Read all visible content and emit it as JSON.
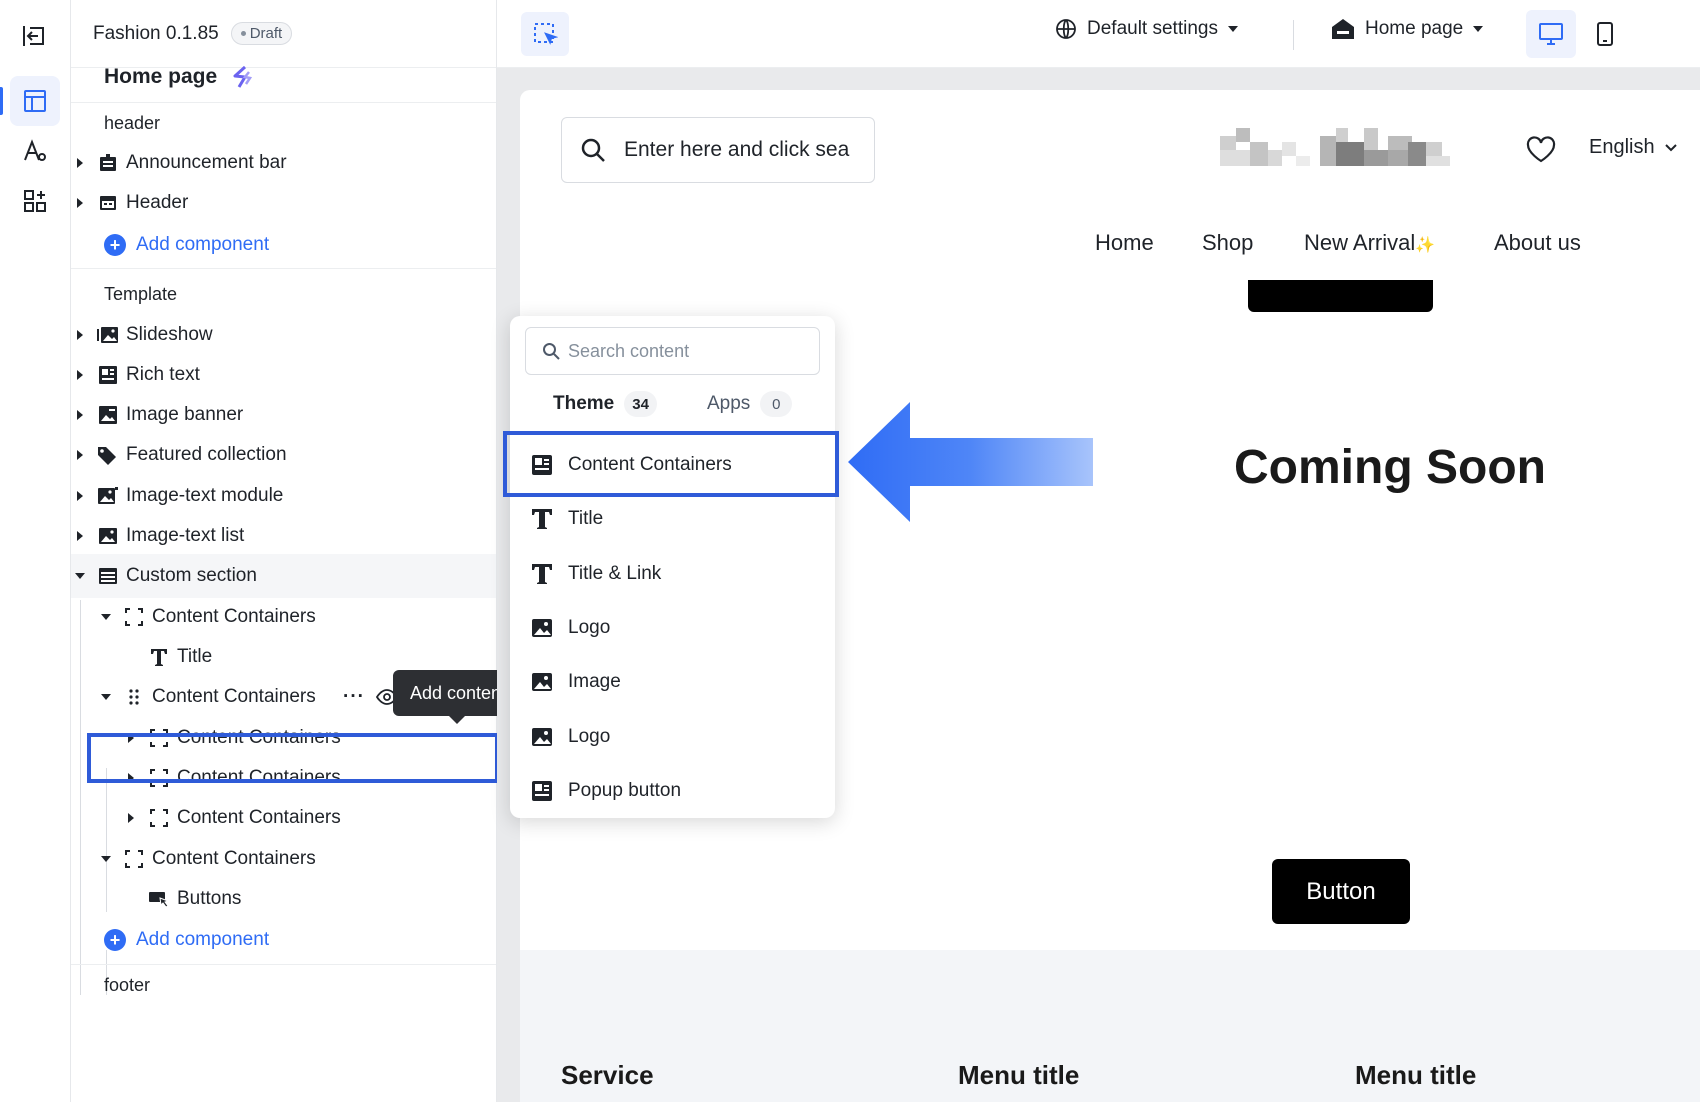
{
  "app": {
    "name": "Fashion 0.1.85",
    "status": "Draft",
    "page_title": "Home page"
  },
  "panel": {
    "header_label": "header",
    "header_items": [
      {
        "label": "Announcement bar"
      },
      {
        "label": "Header"
      }
    ],
    "add_component": "Add component",
    "template_label": "Template",
    "template_items": [
      {
        "label": "Slideshow"
      },
      {
        "label": "Rich text"
      },
      {
        "label": "Image banner"
      },
      {
        "label": "Featured collection"
      },
      {
        "label": "Image-text module"
      },
      {
        "label": "Image-text list"
      },
      {
        "label": "Custom section"
      }
    ],
    "tree": [
      {
        "label": "Content Containers"
      },
      {
        "label": "Title"
      },
      {
        "label": "Content Containers"
      },
      {
        "label": "Content Containers"
      },
      {
        "label": "Content Containers"
      },
      {
        "label": "Content Containers"
      },
      {
        "label": "Content Containers"
      },
      {
        "label": "Buttons"
      }
    ],
    "footer_label": "footer",
    "tooltip": "Add content",
    "more_label": "···"
  },
  "topbar": {
    "settings": "Default settings",
    "page": "Home page"
  },
  "preview": {
    "search_placeholder": "Enter here and click sea",
    "language": "English",
    "nav": [
      "Home",
      "Shop",
      "New Arrival",
      "About us"
    ],
    "sparkle": "✨",
    "coming": "Coming Soon",
    "button": "Button",
    "footer_heads": [
      "Service",
      "Menu title",
      "Menu title"
    ]
  },
  "popup": {
    "search_placeholder": "Search content",
    "tabs": [
      {
        "label": "Theme",
        "count": "34"
      },
      {
        "label": "Apps",
        "count": "0"
      }
    ],
    "items": [
      {
        "label": "Content Containers",
        "icon": "container-icon"
      },
      {
        "label": "Title",
        "icon": "text-icon"
      },
      {
        "label": "Title & Link",
        "icon": "text-icon"
      },
      {
        "label": "Logo",
        "icon": "image-icon"
      },
      {
        "label": "Image",
        "icon": "image-icon"
      },
      {
        "label": "Logo",
        "icon": "image-icon"
      },
      {
        "label": "Popup button",
        "icon": "container-icon"
      }
    ]
  },
  "colors": {
    "accent": "#2f6cf5",
    "highlight": "#2f5bd8",
    "dark": "#1f2329"
  }
}
